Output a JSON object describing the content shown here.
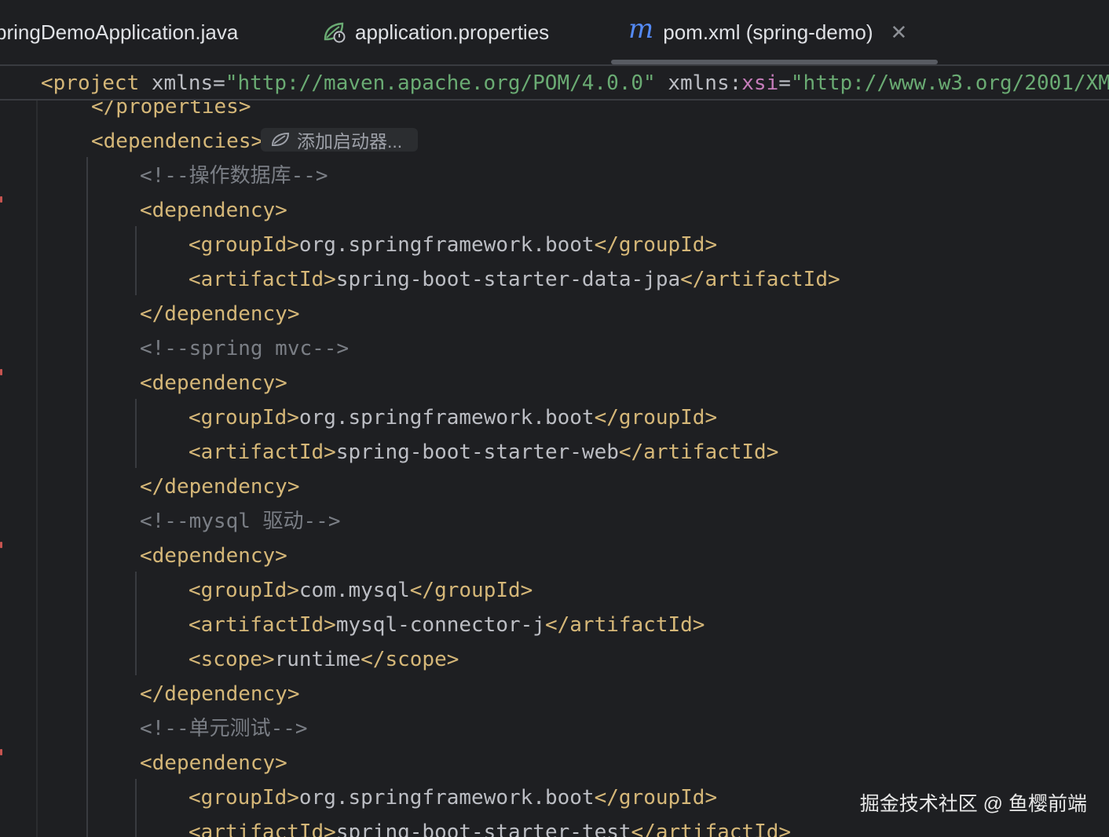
{
  "tabs": [
    {
      "label": "pringDemoApplication.java"
    },
    {
      "label": "application.properties"
    },
    {
      "label": "pom.xml (spring-demo)",
      "icon_letter": "m",
      "active": true
    }
  ],
  "tab_close_glyph": "✕",
  "sticky": {
    "open": "<project",
    "attr1": " xmlns",
    "eq1": "=",
    "val1": "\"http://maven.apache.org/POM/4.0.0\"",
    "attr2_prefix": " xmlns",
    "attr2_colon": ":",
    "attr2_local": "xsi",
    "eq2": "=",
    "val2": "\"http://www.w3.org/2001/XM"
  },
  "starter_chip": {
    "label": "添加启动器..."
  },
  "code": {
    "l0": {
      "tag": "</properties>"
    },
    "l1": {
      "tag": "<dependencies>"
    },
    "l2": {
      "comment": "<!--操作数据库-->"
    },
    "l3": {
      "tag": "<dependency>"
    },
    "l4": {
      "open": "<groupId>",
      "text": "org.springframework.boot",
      "close": "</groupId>"
    },
    "l5": {
      "open": "<artifactId>",
      "text": "spring-boot-starter-data-jpa",
      "close": "</artifactId>"
    },
    "l6": {
      "tag": "</dependency>"
    },
    "l7": {
      "comment": "<!--spring mvc-->"
    },
    "l8": {
      "tag": "<dependency>"
    },
    "l9": {
      "open": "<groupId>",
      "text": "org.springframework.boot",
      "close": "</groupId>"
    },
    "l10": {
      "open": "<artifactId>",
      "text": "spring-boot-starter-web",
      "close": "</artifactId>"
    },
    "l11": {
      "tag": "</dependency>"
    },
    "l12": {
      "comment": "<!--mysql 驱动-->"
    },
    "l13": {
      "tag": "<dependency>"
    },
    "l14": {
      "open": "<groupId>",
      "text": "com.mysql",
      "close": "</groupId>"
    },
    "l15": {
      "open": "<artifactId>",
      "text": "mysql-connector-j",
      "close": "</artifactId>"
    },
    "l16": {
      "open": "<scope>",
      "text": "runtime",
      "close": "</scope>"
    },
    "l17": {
      "tag": "</dependency>"
    },
    "l18": {
      "comment": "<!--单元测试-->"
    },
    "l19": {
      "tag": "<dependency>"
    },
    "l20": {
      "open": "<groupId>",
      "text": "org.springframework.boot",
      "close": "</groupId>"
    },
    "l21": {
      "open": "<artifactId>",
      "text": "spring-boot-starter-test",
      "close": "</artifactId>"
    }
  },
  "watermark": "掘金技术社区 @ 鱼樱前端",
  "colors": {
    "background": "#1e1f22",
    "tag": "#d5b778",
    "text": "#bcbec4",
    "comment": "#7a7e85",
    "string": "#6aab73",
    "namespace": "#c77dbb",
    "maven_icon": "#548af7"
  }
}
